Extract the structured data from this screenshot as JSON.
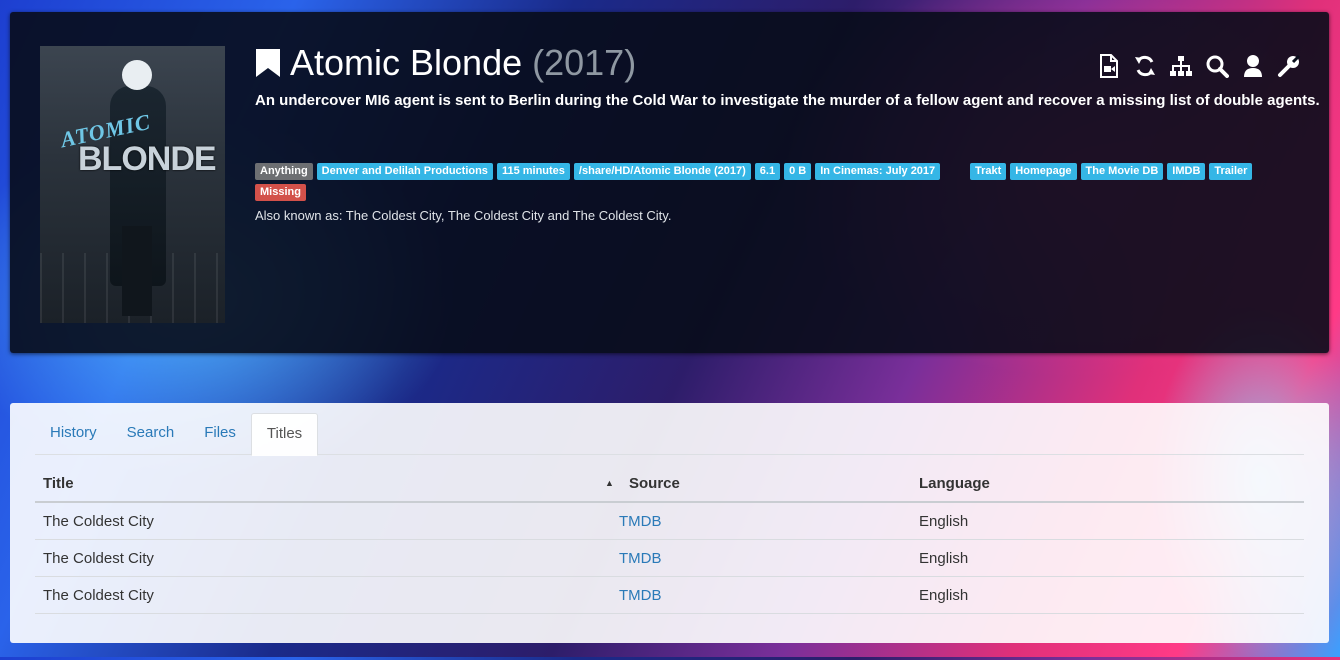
{
  "movie": {
    "title": "Atomic Blonde",
    "year": "(2017)",
    "overview": "An undercover MI6 agent is sent to Berlin during the Cold War to investigate the murder of a fellow agent and recover a missing list of double agents.",
    "poster": {
      "word1": "ATOMIC",
      "word2": "BLONDE"
    },
    "labels": [
      {
        "text": "Anything",
        "style": "grey"
      },
      {
        "text": "Denver and Delilah Productions",
        "style": "info"
      },
      {
        "text": "115 minutes",
        "style": "info"
      },
      {
        "text": "/share/HD/Atomic Blonde (2017)",
        "style": "info"
      },
      {
        "text": "6.1",
        "style": "info"
      },
      {
        "text": "0 B",
        "style": "info"
      },
      {
        "text": "In Cinemas: July 2017",
        "style": "info"
      }
    ],
    "links": [
      "Trakt",
      "Homepage",
      "The Movie DB",
      "IMDB",
      "Trailer"
    ],
    "status_label": "Missing",
    "also_known_as": "Also known as: The Coldest City, The Coldest City and The Coldest City."
  },
  "actions": [
    {
      "name": "file-video-icon"
    },
    {
      "name": "refresh-icon"
    },
    {
      "name": "sitemap-icon"
    },
    {
      "name": "search-icon"
    },
    {
      "name": "user-icon"
    },
    {
      "name": "wrench-icon"
    }
  ],
  "tabs": [
    "History",
    "Search",
    "Files",
    "Titles"
  ],
  "active_tab": "Titles",
  "table": {
    "headers": [
      "Title",
      "Source",
      "Language"
    ],
    "rows": [
      [
        "The Coldest City",
        "TMDB",
        "English"
      ],
      [
        "The Coldest City",
        "TMDB",
        "English"
      ],
      [
        "The Coldest City",
        "TMDB",
        "English"
      ]
    ]
  },
  "colors": {
    "label_grey": "#6d6f72",
    "label_info": "#35b6e6",
    "label_danger": "#d3514a",
    "link": "#2a7ab8"
  }
}
